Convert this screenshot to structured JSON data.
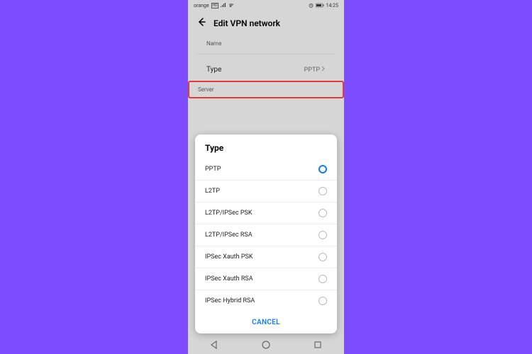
{
  "statusBar": {
    "leftText": "orange",
    "hd": "HD",
    "time": "14:25",
    "battery": "81"
  },
  "header": {
    "title": "Edit VPN network"
  },
  "fields": {
    "nameLabel": "Name",
    "typeLabel": "Type",
    "typeValue": "PPTP",
    "serverLabel": "Server"
  },
  "dialog": {
    "title": "Type",
    "options": [
      {
        "label": "PPTP",
        "selected": true
      },
      {
        "label": "L2TP",
        "selected": false
      },
      {
        "label": "L2TP/IPSec PSK",
        "selected": false
      },
      {
        "label": "L2TP/IPSec RSA",
        "selected": false
      },
      {
        "label": "IPSec Xauth PSK",
        "selected": false
      },
      {
        "label": "IPSec Xauth RSA",
        "selected": false
      },
      {
        "label": "IPSec Hybrid RSA",
        "selected": false
      }
    ],
    "cancel": "CANCEL"
  }
}
